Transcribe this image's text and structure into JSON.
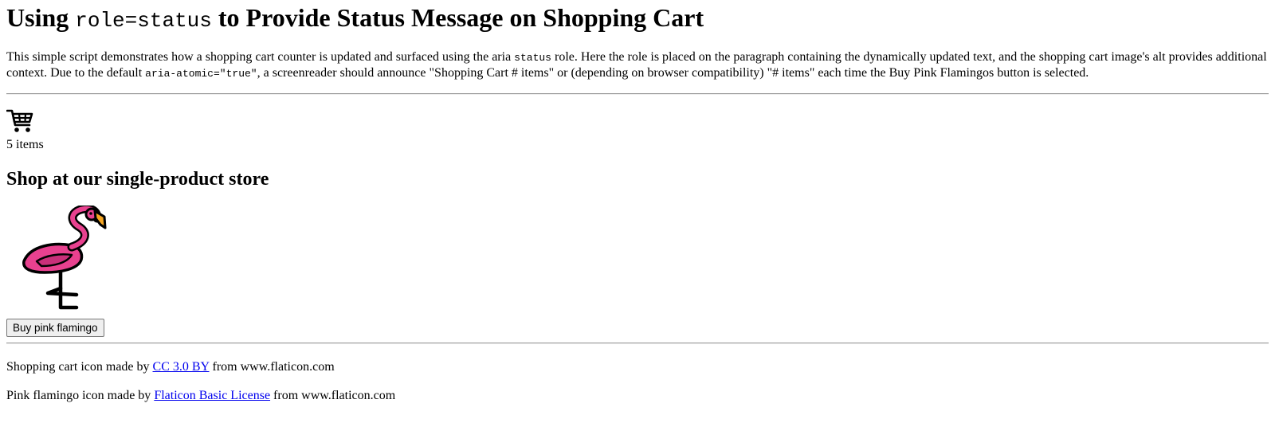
{
  "header": {
    "title_prefix": "Using ",
    "title_code": "role=status",
    "title_suffix": " to Provide Status Message on Shopping Cart"
  },
  "intro": {
    "part1": "This simple script demonstrates how a shopping cart counter is updated and surfaced using the aria ",
    "code1": "status",
    "part2": " role. Here the role is placed on the paragraph containing the dynamically updated text, and the shopping cart image's alt provides additional context. Due to the default ",
    "code2": "aria-atomic=\"true\"",
    "part3": ", a screenreader should announce \"Shopping Cart # items\" or (depending on browser compatibility) \"# items\" each time the Buy Pink Flamingos button is selected."
  },
  "cart": {
    "icon": "shopping-cart-icon",
    "count_text": "5 items"
  },
  "store": {
    "heading": "Shop at our single-product store",
    "product_icon": "pink-flamingo-icon",
    "buy_button_label": "Buy pink flamingo"
  },
  "credits": [
    {
      "prefix": "Shopping cart icon made by ",
      "link_text": "CC 3.0 BY",
      "suffix": " from www.flaticon.com"
    },
    {
      "prefix": "Pink flamingo icon made by ",
      "link_text": "Flaticon Basic License",
      "suffix": " from www.flaticon.com"
    }
  ],
  "colors": {
    "link": "#0000ee",
    "flamingo_pink": "#e8418f",
    "flamingo_beak": "#f5a623"
  }
}
